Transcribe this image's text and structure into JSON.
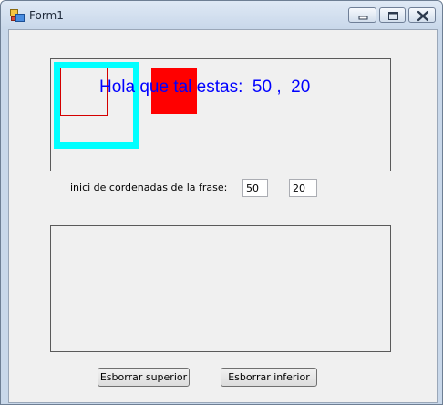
{
  "window": {
    "title": "Form1",
    "icon": "form-app-icon",
    "controls": [
      "minimize-icon",
      "maximize-icon",
      "close-icon"
    ]
  },
  "top_panel": {
    "phrase": "Hola que tal estas:  50 ,  20",
    "phrase_color": "#0000ff",
    "shapes": {
      "cyan_rect_color": "#00ffff",
      "red_outline_color": "#d40000",
      "red_fill_color": "#ff0000"
    }
  },
  "coords": {
    "label": "inici de cordenadas de la frase:",
    "x_value": "50",
    "y_value": "20"
  },
  "buttons": {
    "clear_top": "Esborrar superior",
    "clear_bottom": "Esborrar inferior"
  }
}
